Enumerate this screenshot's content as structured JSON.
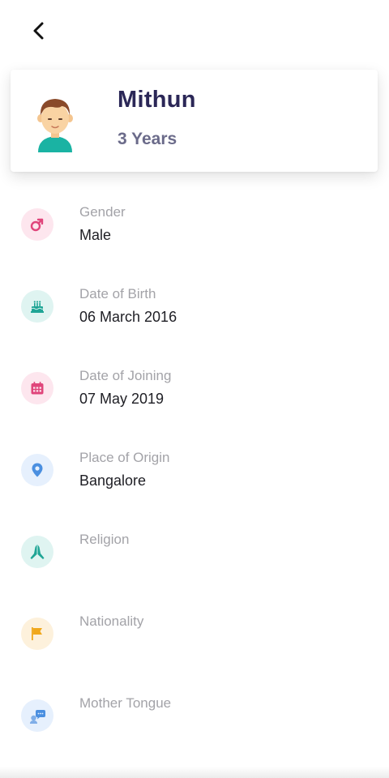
{
  "profile": {
    "name": "Mithun",
    "age": "3 Years"
  },
  "details": [
    {
      "label": "Gender",
      "value": "Male",
      "icon": "male-icon",
      "icon_bg": "#fde6ee",
      "icon_color": "#e0457b"
    },
    {
      "label": "Date of Birth",
      "value": "06 March 2016",
      "icon": "cake-icon",
      "icon_bg": "#dff4f1",
      "icon_color": "#1fa595"
    },
    {
      "label": "Date of Joining",
      "value": "07 May 2019",
      "icon": "calendar-icon",
      "icon_bg": "#fde6ee",
      "icon_color": "#e0457b"
    },
    {
      "label": "Place of Origin",
      "value": "Bangalore",
      "icon": "location-pin-icon",
      "icon_bg": "#e6f0fd",
      "icon_color": "#4a8fe0"
    },
    {
      "label": "Religion",
      "value": "",
      "icon": "praying-hands-icon",
      "icon_bg": "#dff4f1",
      "icon_color": "#1fa595"
    },
    {
      "label": "Nationality",
      "value": "",
      "icon": "flag-icon",
      "icon_bg": "#fdf1dc",
      "icon_color": "#f0a81c"
    },
    {
      "label": "Mother Tongue",
      "value": "",
      "icon": "speech-bubble-icon",
      "icon_bg": "#e6f0fd",
      "icon_color": "#4a8fe0"
    }
  ]
}
